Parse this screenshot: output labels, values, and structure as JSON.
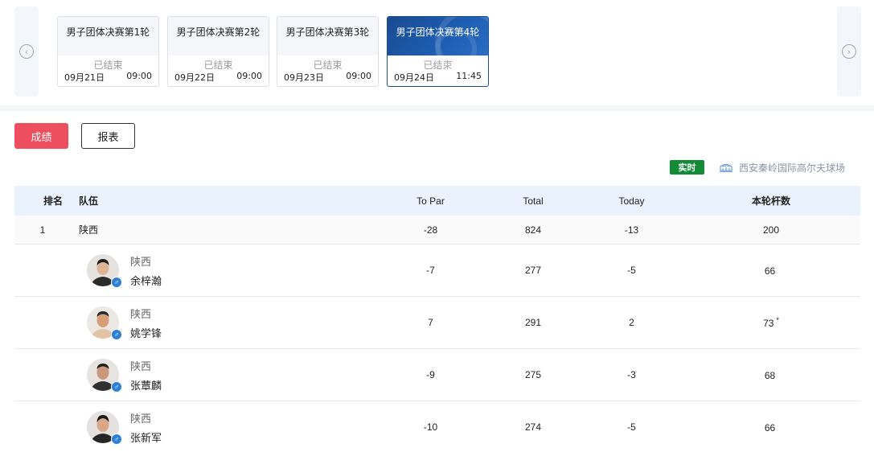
{
  "rounds": [
    {
      "title": "男子团体决赛第1轮",
      "status": "已结束",
      "date": "09月21日",
      "time": "09:00",
      "active": false
    },
    {
      "title": "男子团体决赛第2轮",
      "status": "已结束",
      "date": "09月22日",
      "time": "09:00",
      "active": false
    },
    {
      "title": "男子团体决赛第3轮",
      "status": "已结束",
      "date": "09月23日",
      "time": "09:00",
      "active": false
    },
    {
      "title": "男子团体决赛第4轮",
      "status": "已结束",
      "date": "09月24日",
      "time": "11:45",
      "active": true
    }
  ],
  "nav": {
    "prev_icon": "chevron-left-circle-icon",
    "next_icon": "chevron-right-circle-icon"
  },
  "actions": {
    "results_label": "成绩",
    "report_label": "报表"
  },
  "live_label": "实时",
  "venue": {
    "icon": "stadium-icon",
    "name": "西安秦岭国际高尔夫球场"
  },
  "table": {
    "headers": {
      "rank": "排名",
      "team": "队伍",
      "topar": "To Par",
      "total": "Total",
      "today": "Today",
      "strokes": "本轮杆数"
    },
    "team_row": {
      "rank": "1",
      "team": "陕西",
      "topar": "-28",
      "total": "824",
      "today": "-13",
      "strokes": "200"
    },
    "players": [
      {
        "team": "陕西",
        "name": "余梓瀚",
        "topar": "-7",
        "total": "277",
        "today": "-5",
        "strokes": "66",
        "mark": ""
      },
      {
        "team": "陕西",
        "name": "姚学锋",
        "topar": "7",
        "total": "291",
        "today": "2",
        "strokes": "73",
        "mark": "*"
      },
      {
        "team": "陕西",
        "name": "张蕈麟",
        "topar": "-9",
        "total": "275",
        "today": "-3",
        "strokes": "68",
        "mark": ""
      },
      {
        "team": "陕西",
        "name": "张新军",
        "topar": "-10",
        "total": "274",
        "today": "-5",
        "strokes": "66",
        "mark": ""
      }
    ],
    "gender_symbol": "♂"
  },
  "colors": {
    "primary": "#ee4f5e",
    "active_round": "#1d5cb0",
    "live": "#138a36",
    "header_bg": "#e9f2fd",
    "gender": "#2d7fd8"
  }
}
